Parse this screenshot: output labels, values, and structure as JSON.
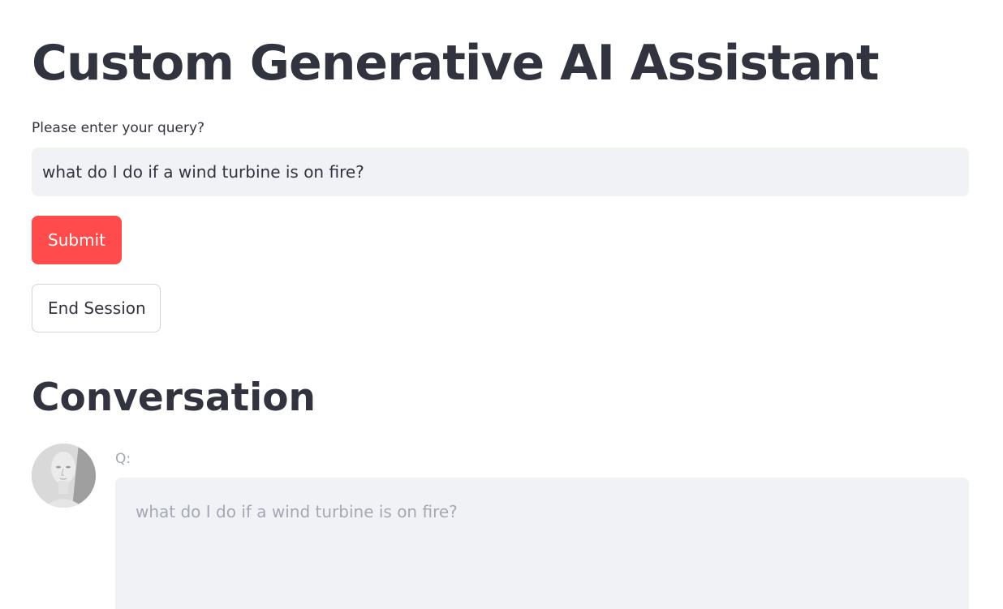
{
  "app": {
    "title": "Custom Generative AI Assistant"
  },
  "query": {
    "label": "Please enter your query?",
    "value": "what do I do if a wind turbine is on fire?"
  },
  "buttons": {
    "submit_label": "Submit",
    "end_session_label": "End Session"
  },
  "conversation": {
    "heading": "Conversation",
    "messages": [
      {
        "avatar_icon": "mannequin-head-icon",
        "label": "Q:",
        "text": "what do I do if a wind turbine is on fire?"
      }
    ]
  },
  "colors": {
    "accent": "#ff4b4b",
    "text": "#31333f",
    "input_bg": "#f0f2f6",
    "muted_text": "#a3a8b4"
  }
}
